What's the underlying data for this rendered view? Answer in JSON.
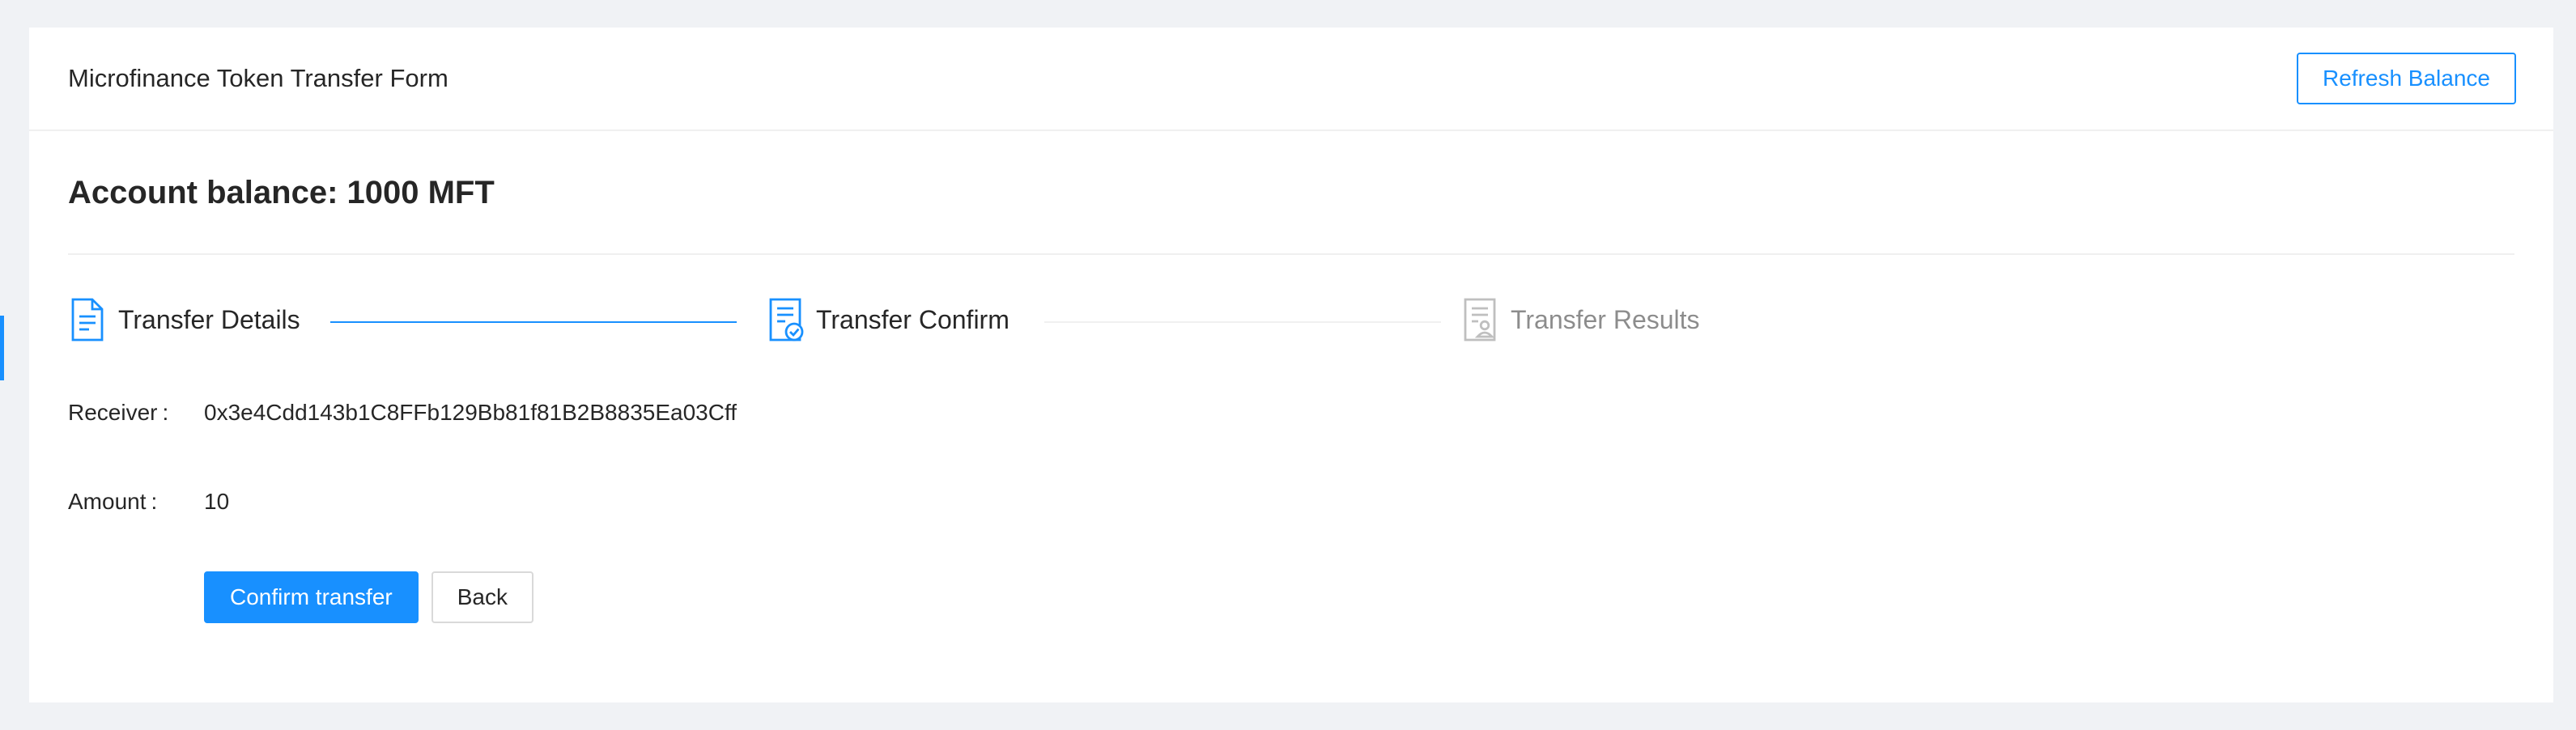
{
  "header": {
    "title": "Microfinance Token Transfer Form",
    "refresh_label": "Refresh Balance"
  },
  "balance": {
    "text": "Account balance: 1000 MFT"
  },
  "steps": [
    {
      "label": "Transfer Details",
      "icon": "file-text-icon",
      "state": "finished"
    },
    {
      "label": "Transfer Confirm",
      "icon": "file-check-icon",
      "state": "current"
    },
    {
      "label": "Transfer Results",
      "icon": "file-user-icon",
      "state": "waiting"
    }
  ],
  "form": {
    "receiver_label": "Receiver",
    "receiver_value": "0x3e4Cdd143b1C8FFb129Bb81f81B2B8835Ea03Cff",
    "amount_label": "Amount",
    "amount_value": "10",
    "colon": ":"
  },
  "actions": {
    "confirm_label": "Confirm transfer",
    "back_label": "Back"
  },
  "colors": {
    "primary": "#1890ff",
    "waiting": "#bfbfbf",
    "background": "#f0f2f5"
  }
}
